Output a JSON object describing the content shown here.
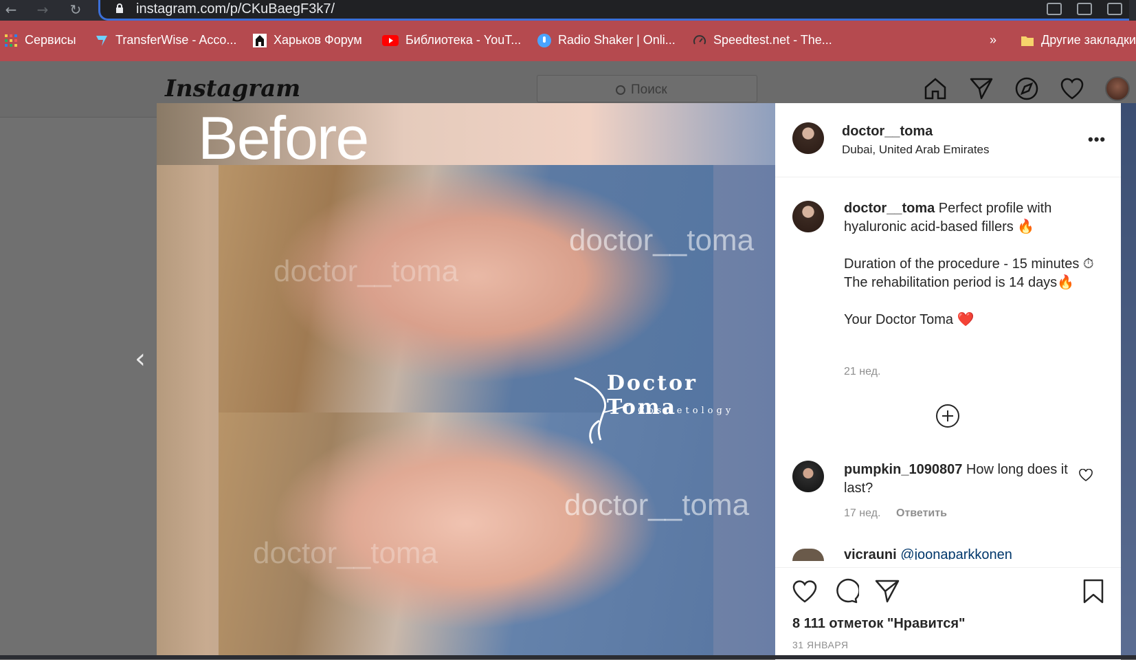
{
  "browser": {
    "url": "instagram.com/p/CKuBaegF3k7/",
    "bookmarks": [
      {
        "label": "Сервисы",
        "icon": "apps-grid-icon"
      },
      {
        "label": "TransferWise - Acco...",
        "icon": "transferwise-icon"
      },
      {
        "label": "Харьков Форум",
        "icon": "forum-icon"
      },
      {
        "label": "Библиотека - YouT...",
        "icon": "youtube-icon"
      },
      {
        "label": "Radio Shaker | Onli...",
        "icon": "radio-icon"
      },
      {
        "label": "Speedtest.net - The...",
        "icon": "speedtest-icon"
      }
    ],
    "more": "»",
    "other_bookmarks": "Другие закладки"
  },
  "instagram": {
    "logo": "Instagram",
    "search_placeholder": "Поиск"
  },
  "post": {
    "image": {
      "before_text": "Before",
      "watermark": "doctor__toma",
      "brand_name": "Doctor Toma",
      "brand_sub": "Cosmetology"
    },
    "author": {
      "username": "doctor__toma",
      "location": "Dubai, United Arab Emirates"
    },
    "more": "•••",
    "caption": {
      "username": "doctor__toma",
      "line1": " Perfect profile with hyaluronic acid-based fillers 🔥",
      "line2": "Duration of the procedure - 15 minutes ⏱",
      "line3": "The rehabilitation period is 14 days🔥",
      "line4": "Your Doctor Toma ❤️",
      "time": "21 нед."
    },
    "comments": [
      {
        "username": "pumpkin_1090807",
        "text": " How long does it last?",
        "time": "17 нед.",
        "reply": "Ответить"
      },
      {
        "username": "vicrauni",
        "text": " @joonaparkkonen"
      }
    ],
    "likes": "8 111 отметок \"Нравится\"",
    "date": "31 ЯНВАРЯ"
  },
  "colors": {
    "bookmark_bar": "#b54a4f",
    "chrome_dark": "#2b2d33",
    "accent_blue": "#3b6fd8",
    "like_red": "#ed4956"
  }
}
